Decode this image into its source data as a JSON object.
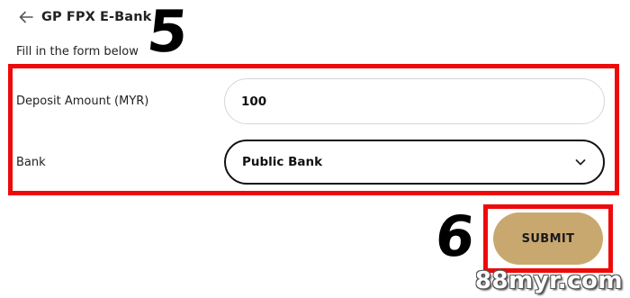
{
  "header": {
    "title": "GP FPX E-Bank",
    "back_icon": "arrow-left-icon"
  },
  "form": {
    "subtitle": "Fill in the form below",
    "amount_label": "Deposit Amount (MYR)",
    "amount_value": "100",
    "bank_label": "Bank",
    "bank_value": "Public Bank",
    "bank_icon": "chevron-down-icon"
  },
  "submit": {
    "label": "SUBMIT",
    "color": "#c9a86f"
  },
  "annotations": {
    "step_form": "5",
    "step_submit": "6",
    "highlight_color": "#ee0a0a"
  },
  "watermark": "88myr.com"
}
